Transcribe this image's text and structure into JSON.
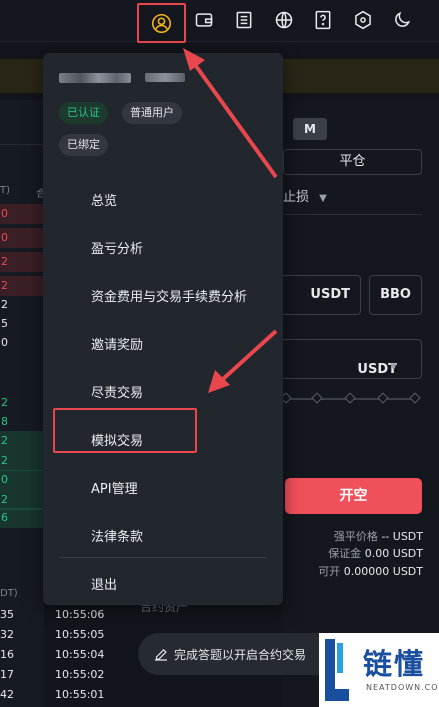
{
  "topbar": {
    "icons": [
      "user-circle-icon",
      "wallet-icon",
      "document-icon",
      "globe-icon",
      "help-icon",
      "cube-icon",
      "moon-icon"
    ]
  },
  "order_book": {
    "col_header_1": "T)",
    "col_header_2": "合",
    "rows": [
      {
        "v": "0",
        "style": "red"
      },
      {
        "v": "0",
        "style": "red"
      },
      {
        "v": "2",
        "style": "red"
      },
      {
        "v": "2",
        "style": "red"
      },
      {
        "v": "2",
        "style": "white"
      },
      {
        "v": "5",
        "style": "white"
      },
      {
        "v": "0",
        "style": "white"
      },
      {
        "v": "2",
        "style": "green"
      },
      {
        "v": "8",
        "style": "green"
      },
      {
        "v": "2",
        "style": "green-bg"
      },
      {
        "v": "2",
        "style": "green-bg"
      },
      {
        "v": "0",
        "style": "green-bg"
      },
      {
        "v": "2",
        "style": "green-bg"
      },
      {
        "v": "6",
        "style": "green-bg"
      }
    ]
  },
  "trades": {
    "header": "DT)",
    "rows": [
      {
        "price": "35",
        "time": "10:55:06"
      },
      {
        "price": "32",
        "time": "10:55:05"
      },
      {
        "price": "16",
        "time": "10:55:04"
      },
      {
        "price": "17",
        "time": "10:55:02"
      },
      {
        "price": "42",
        "time": "10:55:01"
      }
    ]
  },
  "order_panel": {
    "mode_m": "M",
    "close_position": "平仓",
    "stop_loss": "止损",
    "unit_1": "USDT",
    "bbo": "BBO",
    "unit_2": "USDT",
    "open_short": "开空",
    "liq_price_label": "强平价格",
    "liq_price_value": "-- USDT",
    "margin_label": "保证金",
    "margin_value": "0.00 USDT",
    "available_label": "可开",
    "available_value": "0.00000 USDT"
  },
  "bottom": {
    "quiz_button": "完成答题以开启合约交易",
    "faded_text": "合约资产"
  },
  "menu": {
    "tag_verified": "已认证",
    "tag_user_type": "普通用户",
    "tag_bound": "已绑定",
    "items": [
      "总览",
      "盈亏分析",
      "资金费用与交易手续费分析",
      "邀请奖励",
      "尽责交易",
      "模拟交易",
      "API管理",
      "法律条款"
    ],
    "logout": "退出"
  },
  "watermark": {
    "text": "链懂",
    "sub": "NEATDOWN.COM"
  },
  "colors": {
    "highlight": "#e8484d",
    "accent_yellow": "#f2b31b",
    "short_red": "#f0505a",
    "verified_green": "#2fc38a"
  }
}
